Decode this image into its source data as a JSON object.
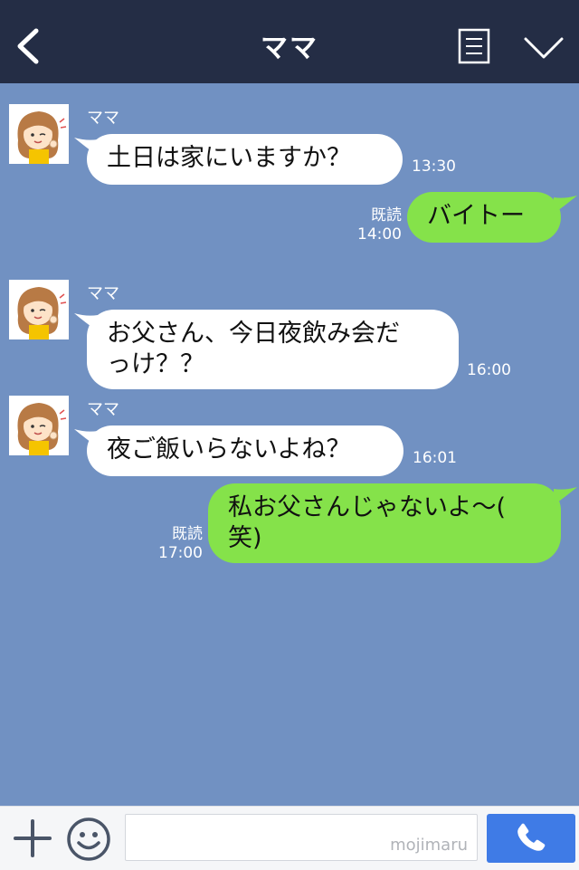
{
  "header": {
    "title": "ママ"
  },
  "messages": [
    {
      "sender": "ママ",
      "text": "土日は家にいますか？",
      "time": "13:30"
    },
    {
      "text": "バイトー",
      "read": "既読",
      "time": "14:00"
    },
    {
      "sender": "ママ",
      "text_lines": [
        "お父さん、今日夜飲み会だ",
        "っけ？？"
      ],
      "time": "16:00"
    },
    {
      "sender": "ママ",
      "text": "夜ご飯いらないよね？",
      "time": "16:01"
    },
    {
      "text_lines": [
        "私お父さんじゃないよ〜(",
        "笑)"
      ],
      "read": "既読",
      "time": "17:00"
    }
  ],
  "footer": {
    "watermark": "mojimaru"
  },
  "colors": {
    "header_bg": "#242d45",
    "chat_bg": "#7191c2",
    "incoming_bubble": "#ffffff",
    "outgoing_bubble": "#85e24a",
    "call_button": "#3f7be6"
  },
  "icons": [
    "back-icon",
    "menu-icon",
    "chevron-down-icon",
    "plus-icon",
    "emoji-icon",
    "phone-icon"
  ]
}
